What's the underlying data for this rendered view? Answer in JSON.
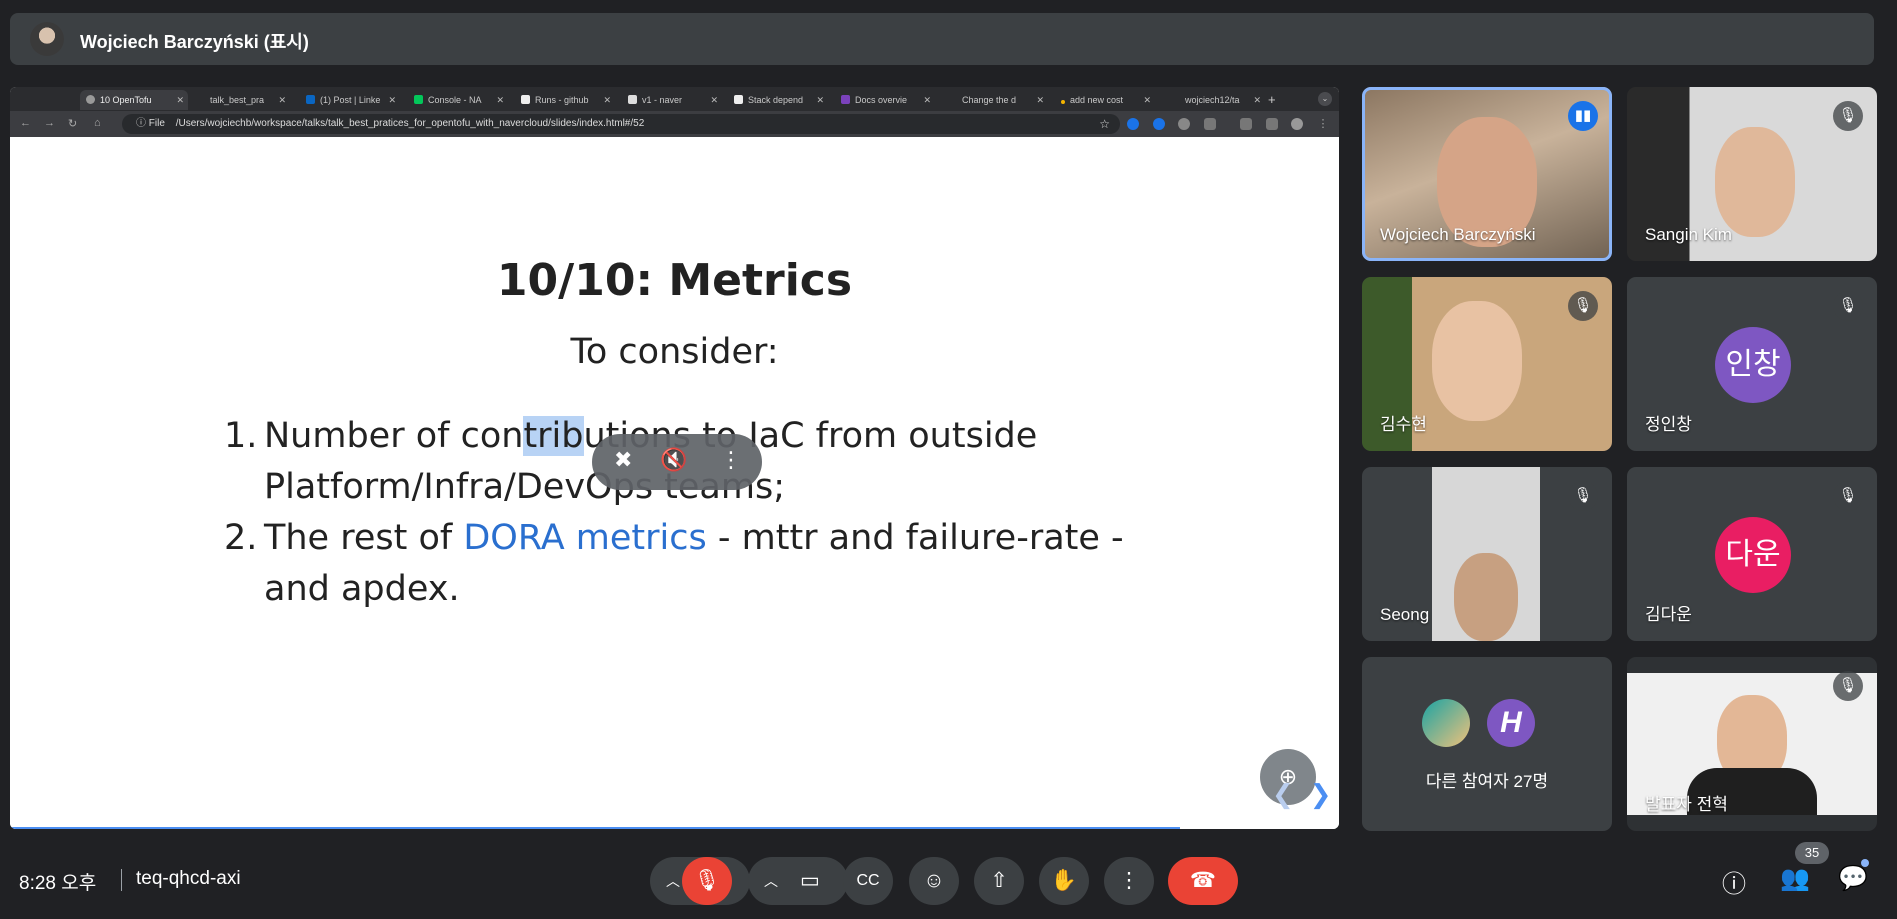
{
  "banner": {
    "presenter_name": "Wojciech Barczyński (표시)"
  },
  "browser": {
    "tabs": [
      {
        "label": "10 OpenTofu",
        "active": true
      },
      {
        "label": "talk_best_pra"
      },
      {
        "label": "(1) Post | Linke"
      },
      {
        "label": "Console - NA"
      },
      {
        "label": "Runs - github"
      },
      {
        "label": "v1 - naver"
      },
      {
        "label": "Stack depend"
      },
      {
        "label": "Docs overvie"
      },
      {
        "label": "Change the d"
      },
      {
        "label": "add new cost"
      },
      {
        "label": "wojciech12/ta"
      }
    ],
    "file_label": "File",
    "url": "/Users/wojciechb/workspace/talks/talk_best_pratices_for_opentofu_with_navercloud/slides/index.html#/52"
  },
  "slide": {
    "title": "10/10: Metrics",
    "subtitle": "To consider:",
    "item1_num": "1.",
    "item1_a": "Number of con",
    "item1_hl": "trib",
    "item1_b": "utions to IaC from outside",
    "item1_line2": "Platform/Infra/DevOps teams;",
    "item2_num": "2.",
    "item2_a": "The rest of ",
    "item2_link": "DORA metrics",
    "item2_b": " - mttr and failure-rate -",
    "item2_line2": "and apdex."
  },
  "participants": [
    {
      "name": "Wojciech Barczyński"
    },
    {
      "name": "Sangin Kim"
    },
    {
      "name": "김수현"
    },
    {
      "name": "정인창",
      "avatar_text": "인창",
      "avatar_color": "#7e57c2"
    },
    {
      "name": "Seong"
    },
    {
      "name": "김다운",
      "avatar_text": "다운",
      "avatar_color": "#e91e63"
    },
    {
      "name": "다른 참여자 27명"
    },
    {
      "name": "발표자 전혁"
    }
  ],
  "others_avatar_letter": "H",
  "footer": {
    "time": "8:28 오후",
    "meeting_code": "teq-qhcd-axi",
    "participant_count": "35"
  },
  "colors": {
    "accent": "#8ab4f8",
    "danger": "#ea4335",
    "tile_bg": "#3c4043"
  }
}
